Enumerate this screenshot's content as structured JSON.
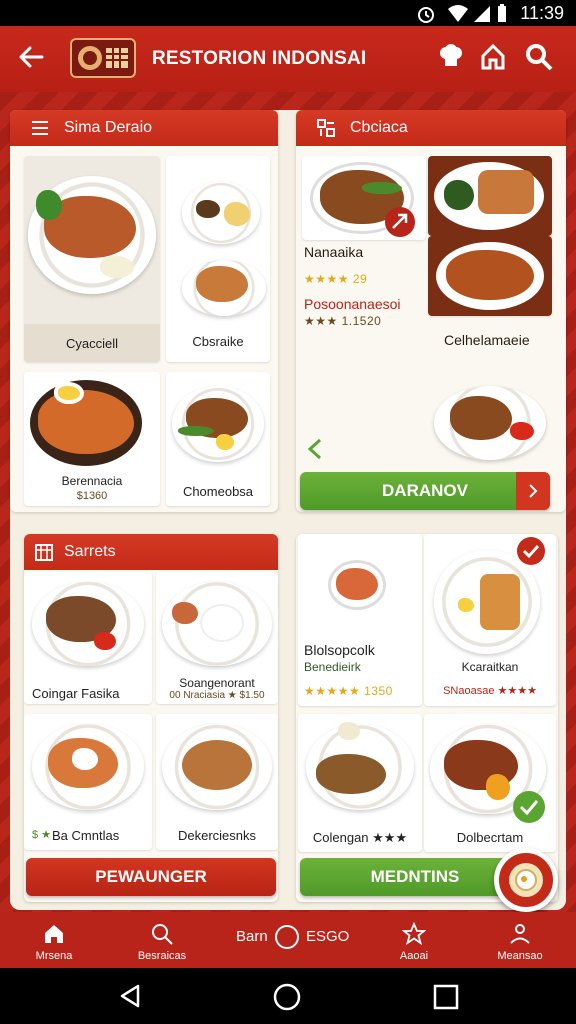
{
  "status_bar": {
    "time": "11:39"
  },
  "app_bar": {
    "title": "RESTORION INDONSAI"
  },
  "sections": {
    "top_left": {
      "title": "Sima Deraio",
      "tiles": [
        {
          "caption": "Cyacciell"
        },
        {
          "caption": "Cbsraike"
        },
        {
          "caption": "Berennacia",
          "price": "$1360"
        },
        {
          "caption": "Chomeobsa"
        }
      ]
    },
    "top_right": {
      "title": "Cbciaca",
      "item_name": "Nanaaika",
      "item_rating": "★★★★ 29",
      "item_promo": "Posoonanaesoi",
      "item_promo_meta": "★★★ 1.1520",
      "right_caption": "Celhelamaeie",
      "button_label": "DARANOV"
    },
    "bottom_left": {
      "title": "Sarrets",
      "tiles": [
        {
          "caption": "Coingar Fasika"
        },
        {
          "caption": "Soangenorant",
          "sub": "00 Nraciasia ★ $1.50"
        },
        {
          "caption": "Ba Cmntlas",
          "prefix": "$ ★"
        },
        {
          "caption": "Dekerciesnks"
        }
      ],
      "button_label": "PEWAUNGER"
    },
    "bottom_right": {
      "tiles": [
        {
          "caption": "Blolsopcolk",
          "sub": "Benedieirk",
          "rating": "★★★★★ 1350"
        },
        {
          "caption": "Kcaraitkan",
          "sub": "SNaoasae ★★★★"
        },
        {
          "caption": "Colengan ★★★"
        },
        {
          "caption": "Dolbecrtam"
        }
      ],
      "button_label": "MEDNTINS"
    }
  },
  "bottom_nav": {
    "items": [
      {
        "label": "Mrsena",
        "icon": "home-icon"
      },
      {
        "label": "Besraicas",
        "icon": "search-icon"
      },
      {
        "label": "Aaoai",
        "icon": "star-icon"
      },
      {
        "label": "Meansao",
        "icon": "profile-icon"
      }
    ],
    "center_left": "Barn",
    "center_right": "ESGO"
  },
  "colors": {
    "primary_red": "#c32a18",
    "accent_green": "#5aa52f",
    "sheet": "#f5efe3"
  }
}
